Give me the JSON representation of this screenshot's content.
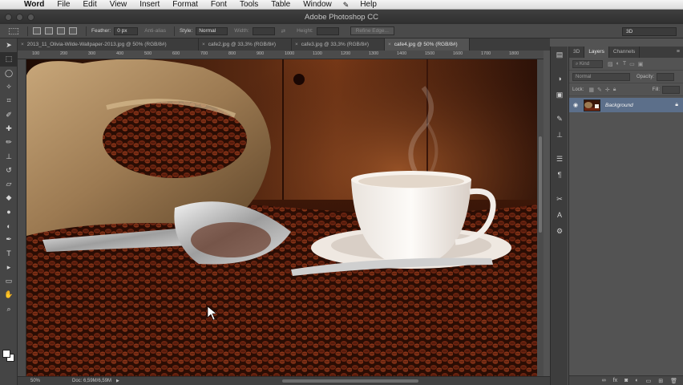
{
  "menubar": {
    "items": [
      "Word",
      "File",
      "Edit",
      "View",
      "Insert",
      "Format",
      "Font",
      "Tools",
      "Table",
      "Window",
      "Help"
    ]
  },
  "window": {
    "title": "Adobe Photoshop CC"
  },
  "options": {
    "feather_label": "Feather:",
    "feather_value": "0 px",
    "antialias_label": "Anti-alias",
    "style_label": "Style:",
    "style_value": "Normal",
    "width_label": "Width:",
    "height_label": "Height:",
    "refine_label": "Refine Edge...",
    "workspace_value": "3D"
  },
  "tabs": [
    {
      "label": "2013_11_Olivia-Wilde-Wallpaper-2013.jpg @ 50% (RGB/8#)"
    },
    {
      "label": "cafe2.jpg @ 33,3% (RGB/8#)"
    },
    {
      "label": "cafe3.jpg @ 33,3% (RGB/8#)"
    },
    {
      "label": "cafe4.jpg @ 50% (RGB/8#)"
    }
  ],
  "ruler": {
    "ticks": [
      "100",
      "200",
      "300",
      "400",
      "500",
      "600",
      "700",
      "800",
      "900",
      "1000",
      "1100",
      "1200",
      "1300",
      "1400",
      "1500",
      "1600",
      "1700",
      "1800"
    ]
  },
  "status": {
    "zoom": "50%",
    "doc": "Doc: 6,59M/6,59M"
  },
  "panel": {
    "tab_3d": "3D",
    "tab_layers": "Layers",
    "tab_channels": "Channels",
    "kind_label": "Kind",
    "blend_value": "Normal",
    "opacity_label": "Opacity:",
    "lock_label": "Lock:",
    "fill_label": "Fill:",
    "layer_name": "Background"
  },
  "colors": {
    "accent": "#5c6f8a",
    "panel": "#535353",
    "chrome": "#3c3c3c"
  }
}
